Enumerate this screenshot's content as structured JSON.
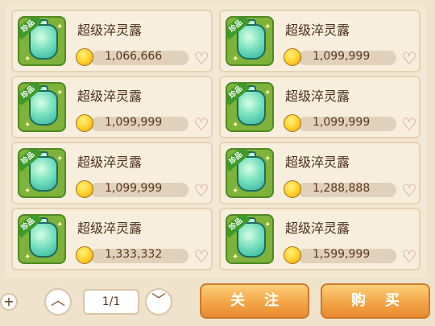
{
  "items": [
    {
      "name": "超级淬灵露",
      "tag": "珍品",
      "price": "1,066,666"
    },
    {
      "name": "超级淬灵露",
      "tag": "珍品",
      "price": "1,099,999"
    },
    {
      "name": "超级淬灵露",
      "tag": "珍品",
      "price": "1,099,999"
    },
    {
      "name": "超级淬灵露",
      "tag": "珍品",
      "price": "1,099,999"
    },
    {
      "name": "超级淬灵露",
      "tag": "珍品",
      "price": "1,099,999"
    },
    {
      "name": "超级淬灵露",
      "tag": "珍品",
      "price": "1,288,888"
    },
    {
      "name": "超级淬灵露",
      "tag": "珍品",
      "price": "1,333,332"
    },
    {
      "name": "超级淬灵露",
      "tag": "珍品",
      "price": "1,599,999"
    }
  ],
  "pagination": {
    "value": "1/1",
    "up_icon": "chevron-up-icon",
    "down_icon": "chevron-down-icon"
  },
  "actions": {
    "follow_label": "关注",
    "buy_label": "购买"
  },
  "left_button": {
    "label": "+"
  },
  "colors": {
    "accent": "#f3a548",
    "panel_bg": "#f3e8d3"
  }
}
